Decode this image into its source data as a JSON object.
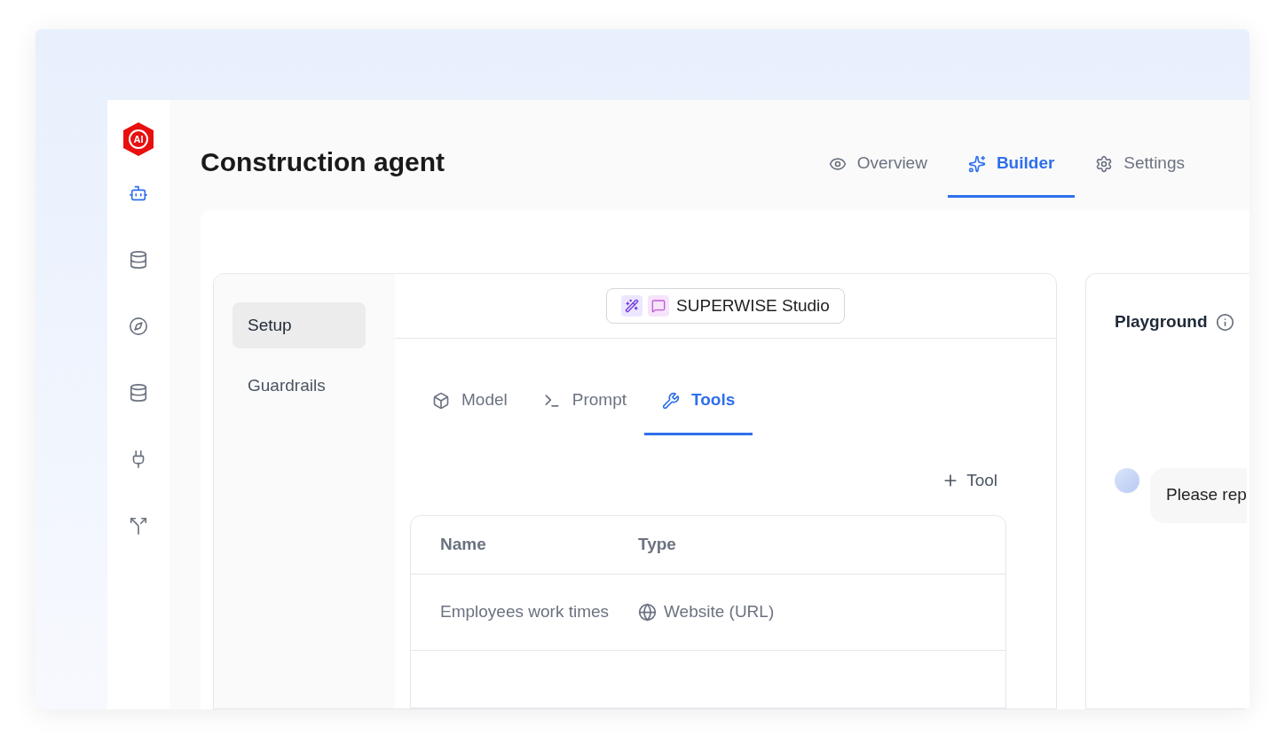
{
  "logo": {
    "text": "AI"
  },
  "sidebar": {
    "items": [
      {
        "kind": "bot",
        "selected": true
      },
      {
        "kind": "database",
        "selected": false
      },
      {
        "kind": "compass",
        "selected": false
      },
      {
        "kind": "database",
        "selected": false
      },
      {
        "kind": "plug",
        "selected": false
      },
      {
        "kind": "split",
        "selected": false
      }
    ]
  },
  "page": {
    "title": "Construction agent"
  },
  "tabs": [
    {
      "kind": "overview",
      "label": "Overview",
      "selected": false
    },
    {
      "kind": "builder",
      "label": "Builder",
      "selected": true
    },
    {
      "kind": "settings",
      "label": "Settings",
      "selected": false
    }
  ],
  "config": {
    "nav": [
      {
        "label": "Setup",
        "selected": true
      },
      {
        "label": "Guardrails",
        "selected": false
      }
    ],
    "studio_button": {
      "label": "SUPERWISE Studio"
    },
    "subtabs": [
      {
        "kind": "model",
        "label": "Model",
        "selected": false
      },
      {
        "kind": "prompt",
        "label": "Prompt",
        "selected": false
      },
      {
        "kind": "tools",
        "label": "Tools",
        "selected": true
      }
    ],
    "add_button": {
      "label": "Tool"
    },
    "table": {
      "columns": [
        "Name",
        "Type"
      ],
      "rows": [
        {
          "name": "Employees work times",
          "type": {
            "kind": "website",
            "label": "Website (URL)"
          }
        }
      ]
    }
  },
  "playground": {
    "title": "Playground",
    "messages": [
      {
        "text": "Please rep"
      }
    ]
  }
}
